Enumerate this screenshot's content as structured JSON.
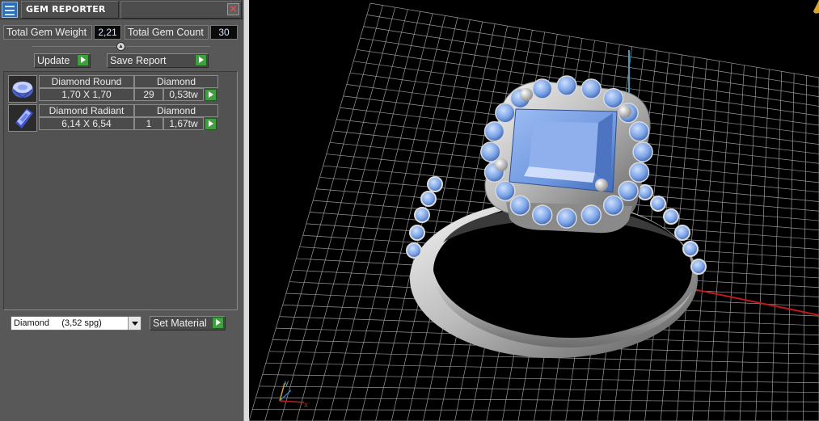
{
  "window": {
    "title": "GEM REPORTER",
    "close_glyph": "✕"
  },
  "summary": {
    "total_weight_label": "Total Gem Weight",
    "total_weight_value": "2,21",
    "total_count_label": "Total Gem Count",
    "total_count_value": "30"
  },
  "toolbar": {
    "update_label": "Update",
    "save_report_label": "Save Report"
  },
  "gems": [
    {
      "name": "Diamond Round",
      "material": "Diamond",
      "size": "1,70 X 1,70",
      "count": "29",
      "weight": "0,53tw",
      "thumb_icon": "round-gem-icon"
    },
    {
      "name": "Diamond Radiant",
      "material": "Diamond",
      "size": "6,14 X 6,54",
      "count": "1",
      "weight": "1,67tw",
      "thumb_icon": "radiant-gem-icon"
    }
  ],
  "material": {
    "selected": "Diamond     (3,52 spg)",
    "set_label": "Set Material"
  },
  "viewport": {
    "axis_x_label": "x",
    "axis_y_label": "y",
    "gem_color": "#7aa3e6",
    "metal_color": "#c8c8c8",
    "grid_color": "#9a9a9a",
    "x_axis_color": "#c21818",
    "y_axis_color": "#2aa6c8"
  },
  "colors": {
    "panel_bg": "#585858",
    "play_green": "#3ea13e",
    "close_red": "#ff4a4a"
  }
}
